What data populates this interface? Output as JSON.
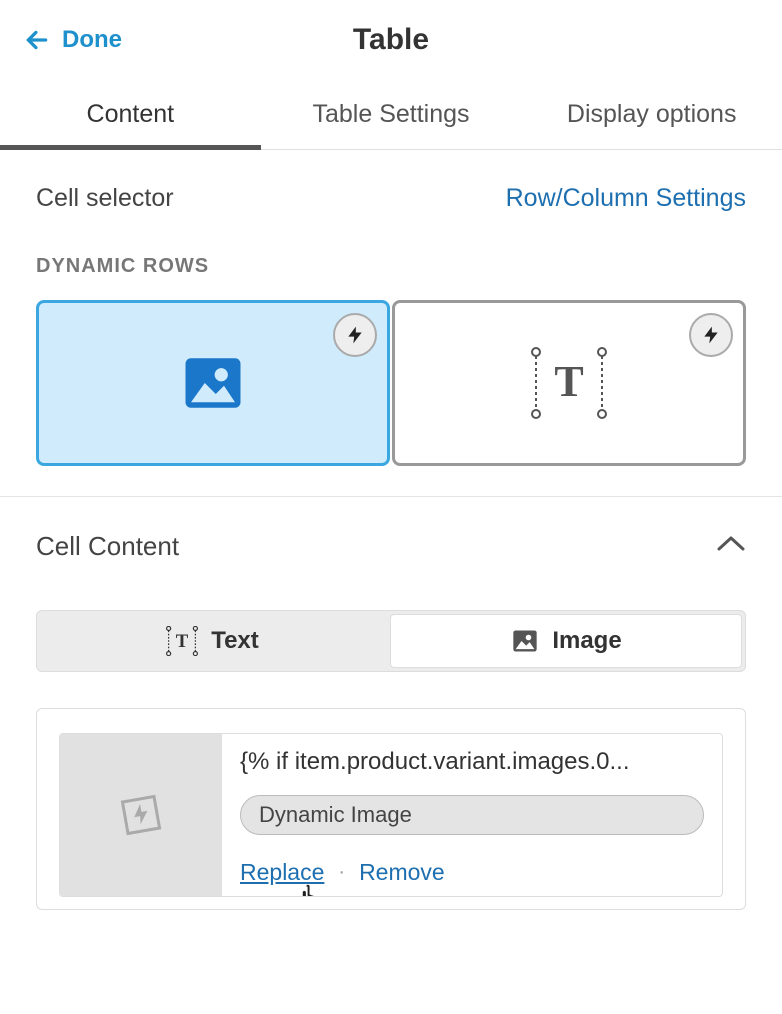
{
  "header": {
    "done_label": "Done",
    "title": "Table"
  },
  "tabs": [
    {
      "label": "Content",
      "active": true
    },
    {
      "label": "Table Settings",
      "active": false
    },
    {
      "label": "Display options",
      "active": false
    }
  ],
  "cell_selector": {
    "label": "Cell selector",
    "link": "Row/Column Settings",
    "subhead": "DYNAMIC ROWS"
  },
  "cell_content": {
    "title": "Cell Content",
    "seg": {
      "text": "Text",
      "image": "Image"
    },
    "media": {
      "code": "{% if item.product.variant.images.0...",
      "pill": "Dynamic Image",
      "replace": "Replace",
      "remove": "Remove"
    }
  }
}
